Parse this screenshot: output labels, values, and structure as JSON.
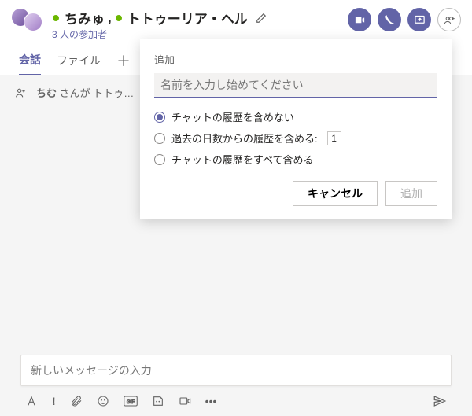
{
  "header": {
    "participant1": "ちみゅ",
    "separator": ",",
    "participant2": "トトゥーリア・ヘル",
    "subtitle": "3 人の参加者"
  },
  "tabs": {
    "conversation": "会話",
    "files": "ファイル"
  },
  "system_message": {
    "prefix": "ちむ",
    "rest": " さんが トトゥ…"
  },
  "dialog": {
    "title": "追加",
    "placeholder": "名前を入力し始めてください",
    "opt_none": "チャットの履歴を含めない",
    "opt_days": "過去の日数からの履歴を含める:",
    "days_value": "1",
    "opt_all": "チャットの履歴をすべて含める",
    "cancel": "キャンセル",
    "add": "追加"
  },
  "composer": {
    "placeholder": "新しいメッセージの入力"
  }
}
